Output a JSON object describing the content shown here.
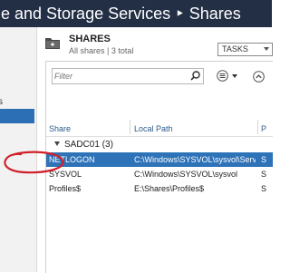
{
  "window": {
    "title": "le and Storage Services ‣ Shares"
  },
  "leftnav": {
    "item_label": "s"
  },
  "section": {
    "title": "SHARES",
    "subtitle": "All shares | 3 total",
    "tasks_label": "TASKS",
    "icon": "shares-folder-icon"
  },
  "filter": {
    "placeholder": "Filter",
    "icon": "search-icon"
  },
  "toolbar": {
    "view_icon": "list-view-icon",
    "collapse_icon": "collapse-up-icon"
  },
  "table": {
    "columns": [
      "Share",
      "Local Path",
      "P"
    ],
    "group_label": "SADC01 (3)",
    "rows": [
      {
        "share": "NETLOGON",
        "path": "C:\\Windows\\SYSVOL\\sysvol\\Serve...",
        "protocol": "S"
      },
      {
        "share": "SYSVOL",
        "path": "C:\\Windows\\SYSVOL\\sysvol",
        "protocol": "S"
      },
      {
        "share": "Profiles$",
        "path": "E:\\Shares\\Profiles$",
        "protocol": "S"
      }
    ],
    "selected_row": 0
  },
  "colors": {
    "titlebar": "#232f45",
    "selection": "#2e72b8",
    "annotation": "#d0202a"
  }
}
